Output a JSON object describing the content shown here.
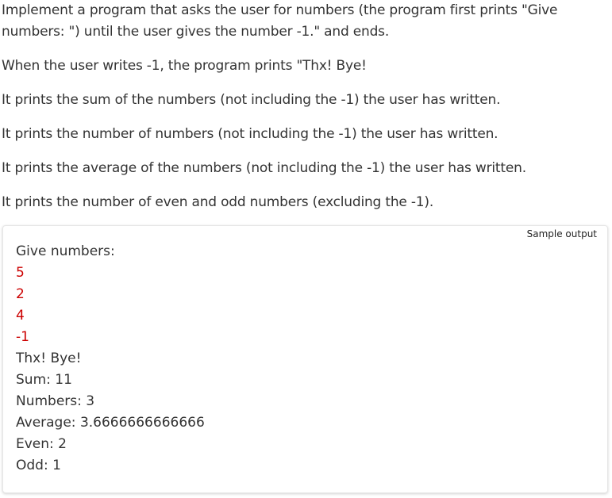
{
  "instructions": {
    "p1": "Implement a program that asks the user for numbers (the program first prints \"Give numbers: \") until the user gives the number -1.\" and ends.",
    "p2": "When the user writes -1, the program prints \"Thx! Bye!",
    "p3": "It prints the sum of the numbers (not including the -1) the user has written.",
    "p4": "It prints the number of numbers (not including the -1) the user has written.",
    "p5": "It prints the average of the numbers (not including the -1) the user has written.",
    "p6": "It prints the number of even and odd numbers (excluding the -1)."
  },
  "sample": {
    "label": "Sample output",
    "input_color": "#cc0000",
    "lines": [
      {
        "text": "Give numbers:",
        "kind": "output"
      },
      {
        "text": "5",
        "kind": "input"
      },
      {
        "text": "2",
        "kind": "input"
      },
      {
        "text": "4",
        "kind": "input"
      },
      {
        "text": "-1",
        "kind": "input"
      },
      {
        "text": "Thx! Bye!",
        "kind": "output"
      },
      {
        "text": "Sum: 11",
        "kind": "output"
      },
      {
        "text": "Numbers: 3",
        "kind": "output"
      },
      {
        "text": "Average: 3.6666666666666",
        "kind": "output"
      },
      {
        "text": "Even: 2",
        "kind": "output"
      },
      {
        "text": "Odd: 1",
        "kind": "output"
      }
    ]
  }
}
